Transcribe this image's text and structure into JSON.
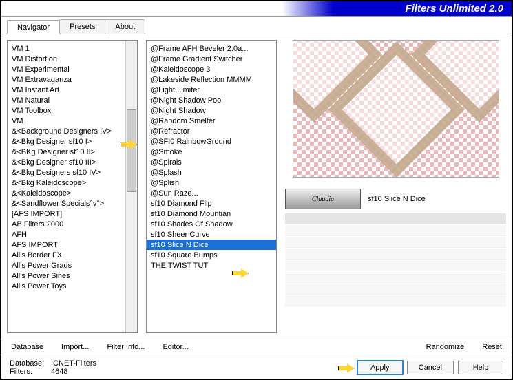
{
  "title": "Filters Unlimited 2.0",
  "tabs": [
    {
      "label": "Navigator",
      "active": true
    },
    {
      "label": "Presets",
      "active": false
    },
    {
      "label": "About",
      "active": false
    }
  ],
  "categoryList": [
    "VM 1",
    "VM Distortion",
    "VM Experimental",
    "VM Extravaganza",
    "VM Instant Art",
    "VM Natural",
    "VM Toolbox",
    "VM",
    "&<Background Designers IV>",
    "&<Bkg Designer sf10 I>",
    "&<BKg Designer sf10 II>",
    "&<Bkg Designer sf10 III>",
    "&<Bkg Designers sf10 IV>",
    "&<Bkg Kaleidoscope>",
    "&<Kaleidoscope>",
    "&<Sandflower Specials°v°>",
    "[AFS IMPORT]",
    "AB Filters 2000",
    "AFH",
    "AFS IMPORT",
    "All's Border FX",
    "All's Power Grads",
    "All's Power Sines",
    "All's Power Toys"
  ],
  "categoryPointerIndex": 8,
  "filterList": [
    "@Frame AFH Beveler 2.0a...",
    "@Frame Gradient Switcher",
    "@Kaleidoscope 3",
    "@Lakeside Reflection MMMM",
    "@Light Limiter",
    "@Night Shadow Pool",
    "@Night Shadow",
    "@Random Smelter",
    "@Refractor",
    "@SFI0 RainbowGround",
    "@Smoke",
    "@Spirals",
    "@Splash",
    "@Splish",
    "@Sun Raze...",
    "sf10 Diamond Flip",
    "sf10 Diamond Mountian",
    "sf10 Shades Of Shadow",
    "sf10 Sheer Curve",
    "sf10 Slice N Dice",
    "sf10 Square Bumps",
    "THE TWIST TUT"
  ],
  "filterSelectedIndex": 19,
  "filterName": "sf10 Slice N Dice",
  "badgeText": "Claudia",
  "toolbar": {
    "database": "Database",
    "import": "Import...",
    "filterInfo": "Filter Info...",
    "editor": "Editor...",
    "randomize": "Randomize",
    "reset": "Reset"
  },
  "footer": {
    "dbLabel": "Database:",
    "dbValue": "ICNET-Filters",
    "countLabel": "Filters:",
    "countValue": "4648",
    "apply": "Apply",
    "cancel": "Cancel",
    "help": "Help"
  }
}
